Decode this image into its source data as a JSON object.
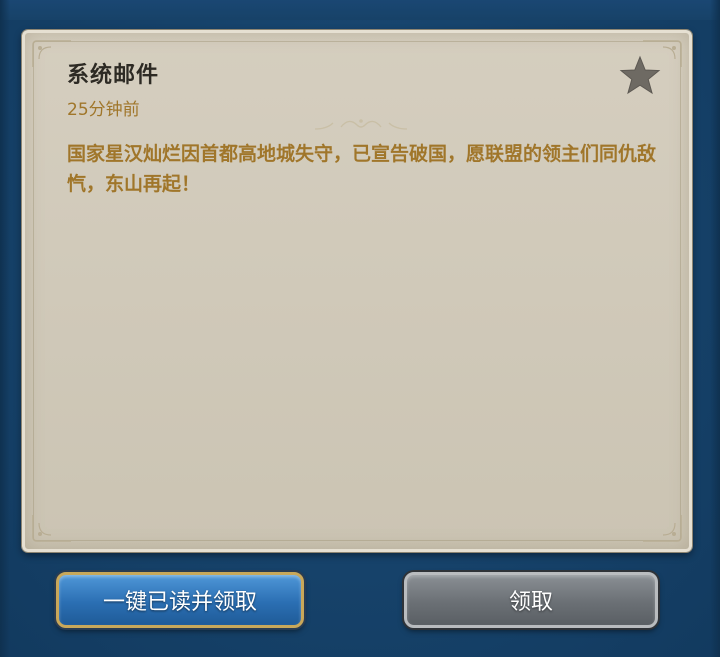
{
  "mail": {
    "title": "系统邮件",
    "time": "25分钟前",
    "body": "国家星汉灿烂因首都高地城失守，已宣告破国，愿联盟的领主们同仇敌忾，东山再起！",
    "starred": false
  },
  "buttons": {
    "read_all_claim": "一键已读并领取",
    "claim": "领取"
  },
  "colors": {
    "background": "#174268",
    "parchment": "#d0c9b9",
    "title_text": "#2d2a24",
    "accent_text": "#a0762a",
    "star": "#6e6a63",
    "primary_button": "#2b6fb3",
    "secondary_button": "#6b7075"
  },
  "icons": {
    "favorite": "star-icon",
    "divider": "ornament-divider"
  }
}
